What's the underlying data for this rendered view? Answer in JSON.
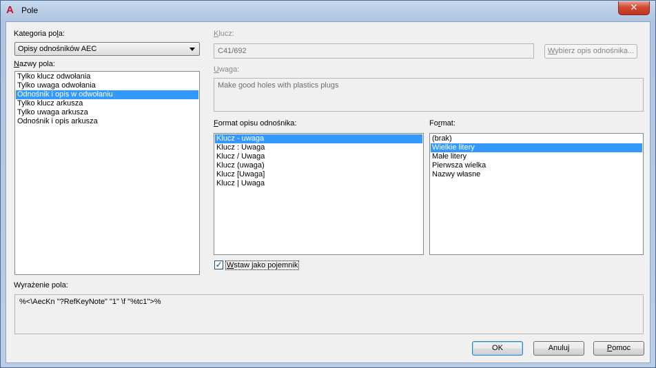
{
  "window": {
    "title": "Pole",
    "app_icon_glyph": "A",
    "close_glyph": "✕"
  },
  "category": {
    "label_pre": "Kategoria po",
    "label_ul": "l",
    "label_post": "a:",
    "selected": "Opisy odnośników AEC"
  },
  "field_names": {
    "label_ul": "N",
    "label_post": "azwy pola:",
    "items": [
      {
        "label": "Tylko klucz odwołania",
        "selected": false
      },
      {
        "label": "Tylko uwaga odwołania",
        "selected": false
      },
      {
        "label": "Odnośnik i opis w odwołaniu",
        "selected": true
      },
      {
        "label": "Tylko klucz arkusza",
        "selected": false
      },
      {
        "label": "Tylko uwaga arkusza",
        "selected": false
      },
      {
        "label": "Odnośnik i opis arkusza",
        "selected": false
      }
    ]
  },
  "key": {
    "label_ul": "K",
    "label_post": "lucz:",
    "value": "C41/692",
    "select_button_ul": "W",
    "select_button_post": "ybierz opis odnośnika..."
  },
  "note": {
    "label_ul": "U",
    "label_post": "waga:",
    "value": "Make good holes with plastics plugs"
  },
  "description_format": {
    "label_ul": "F",
    "label_post": "ormat opisu odnośnika:",
    "items": [
      {
        "label": "Klucz - uwaga",
        "selected": true
      },
      {
        "label": "Klucz : Uwaga",
        "selected": false
      },
      {
        "label": "Klucz / Uwaga",
        "selected": false
      },
      {
        "label": "Klucz (uwaga)",
        "selected": false
      },
      {
        "label": "Klucz [Uwaga]",
        "selected": false
      },
      {
        "label": "Klucz | Uwaga",
        "selected": false
      }
    ]
  },
  "format": {
    "label_pre": "Fo",
    "label_ul": "r",
    "label_post": "mat:",
    "items": [
      {
        "label": "(brak)",
        "selected": false
      },
      {
        "label": "Wielkie litery",
        "selected": true
      },
      {
        "label": "Małe litery",
        "selected": false
      },
      {
        "label": "Pierwsza wielka",
        "selected": false
      },
      {
        "label": "Nazwy własne",
        "selected": false
      }
    ]
  },
  "insert_as_container": {
    "checked": true,
    "check_glyph": "✓",
    "label_ul": "W",
    "label_post": "staw jako pojemnik"
  },
  "expression": {
    "label": "Wyrażenie pola:",
    "value": "%<\\AecKn \"?RefKeyNote\" \"1\" \\f \"%tc1\">%"
  },
  "buttons": {
    "ok": "OK",
    "cancel": "Anuluj",
    "help_ul": "P",
    "help_post": "omoc"
  }
}
